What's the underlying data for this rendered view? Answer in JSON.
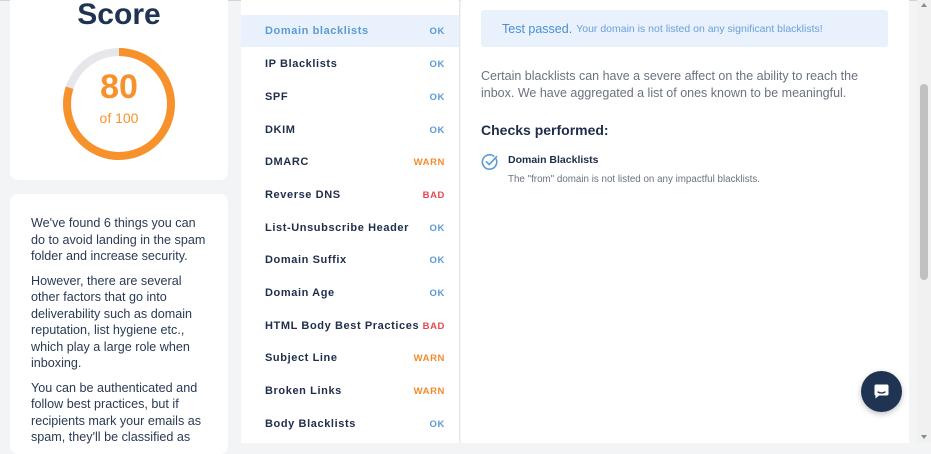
{
  "score": {
    "title": "Score",
    "value": "80",
    "of_label": "of 100",
    "fraction": 0.8,
    "accent_color": "#f7912c",
    "track_color": "#e5e7eb"
  },
  "summary": {
    "paragraphs": [
      "We've found 6 things you can do to avoid landing in the spam folder and increase security.",
      "However, there are several other factors that go into deliverability such as domain reputation, list hygiene etc., which play a large role when inboxing.",
      "You can be authenticated and follow best practices, but if recipients mark your emails as spam, they'll be classified as"
    ]
  },
  "checks": [
    {
      "name": "Domain blacklists",
      "status": "OK",
      "active": true
    },
    {
      "name": "IP Blacklists",
      "status": "OK"
    },
    {
      "name": "SPF",
      "status": "OK"
    },
    {
      "name": "DKIM",
      "status": "OK"
    },
    {
      "name": "DMARC",
      "status": "WARN"
    },
    {
      "name": "Reverse DNS",
      "status": "BAD"
    },
    {
      "name": "List-Unsubscribe Header",
      "status": "OK"
    },
    {
      "name": "Domain Suffix",
      "status": "OK"
    },
    {
      "name": "Domain Age",
      "status": "OK"
    },
    {
      "name": "HTML Body Best Practices",
      "status": "BAD"
    },
    {
      "name": "Subject Line",
      "status": "WARN"
    },
    {
      "name": "Broken Links",
      "status": "WARN"
    },
    {
      "name": "Body Blacklists",
      "status": "OK"
    }
  ],
  "status_colors": {
    "OK": "#5b9bd5",
    "WARN": "#f08c2e",
    "BAD": "#e5484d"
  },
  "detail": {
    "banner_title": "Test passed.",
    "banner_text": "Your domain is not listed on any significant blacklists!",
    "description": "Certain blacklists can have a severe affect on the ability to reach the inbox. We have aggregated a list of ones known to be meaningful.",
    "checks_heading": "Checks performed:",
    "items": [
      {
        "icon": "check-circle-icon",
        "title": "Domain Blacklists",
        "description": "The \"from\" domain is not listed on any impactful blacklists."
      }
    ]
  },
  "chat": {
    "icon": "chat-bubble-icon"
  }
}
